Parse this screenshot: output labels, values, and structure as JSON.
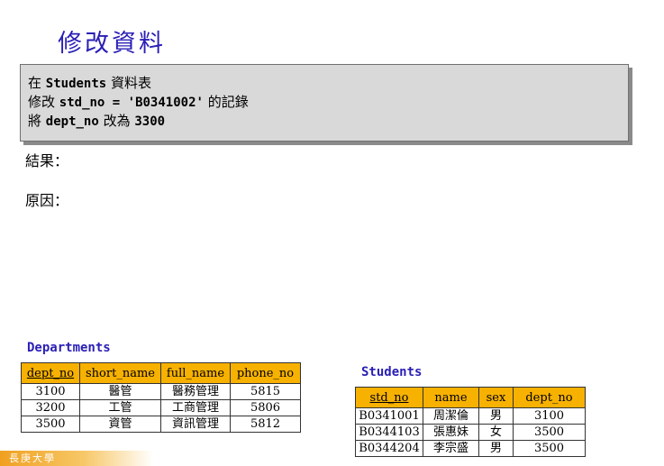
{
  "title": "修改資料",
  "statement": {
    "line1_prefix": "在 ",
    "line1_code": "Students",
    "line1_suffix": " 資料表",
    "line2_prefix": "修改 ",
    "line2_code": "std_no = 'B0341002'",
    "line2_suffix": " 的記錄",
    "line3_prefix": "將 ",
    "line3_code1": "dept_no",
    "line3_mid": " 改為 ",
    "line3_code2": "3300"
  },
  "labels": {
    "result": "結果：",
    "reason": "原因："
  },
  "departments": {
    "title": "Departments",
    "headers": [
      "dept_no",
      "short_name",
      "full_name",
      "phone_no"
    ],
    "rows": [
      [
        "3100",
        "醫管",
        "醫務管理",
        "5815"
      ],
      [
        "3200",
        "工管",
        "工商管理",
        "5806"
      ],
      [
        "3500",
        "資管",
        "資訊管理",
        "5812"
      ]
    ]
  },
  "students": {
    "title": "Students",
    "headers": [
      "std_no",
      "name",
      "sex",
      "dept_no"
    ],
    "rows": [
      [
        "B0341001",
        "周潔倫",
        "男",
        "3100"
      ],
      [
        "B0344103",
        "張惠妹",
        "女",
        "3500"
      ],
      [
        "B0344204",
        "李宗盛",
        "男",
        "3500"
      ]
    ]
  },
  "footer": {
    "logo_text": "長庚大學"
  },
  "colors": {
    "title": "#2a1fb5",
    "header_fill": "#f7b100",
    "box_fill": "#d9d9d9"
  }
}
